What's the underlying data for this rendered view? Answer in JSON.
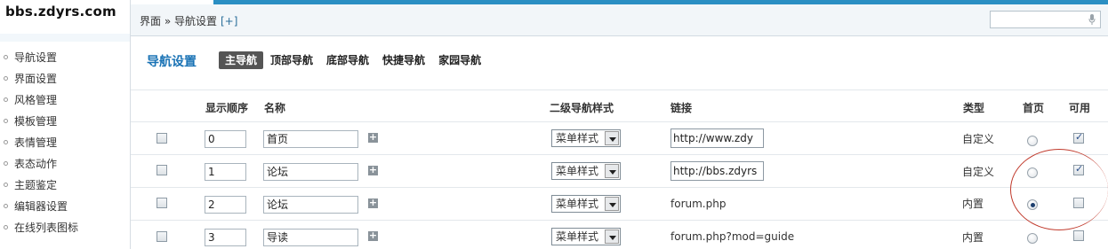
{
  "logo": {
    "text": "bbs.zdyrs.com"
  },
  "sidebar": {
    "items": [
      {
        "label": "导航设置"
      },
      {
        "label": "界面设置"
      },
      {
        "label": "风格管理"
      },
      {
        "label": "模板管理"
      },
      {
        "label": "表情管理"
      },
      {
        "label": "表态动作"
      },
      {
        "label": "主题鉴定"
      },
      {
        "label": "编辑器设置"
      },
      {
        "label": "在线列表图标"
      }
    ]
  },
  "topbar": {
    "breadcrumb": "界面 » 导航设置",
    "breadcrumb_add": "[+]",
    "search_placeholder": ""
  },
  "nav": {
    "title": "导航设置",
    "tabs": [
      {
        "label": "主导航",
        "active": true
      },
      {
        "label": "顶部导航",
        "active": false
      },
      {
        "label": "底部导航",
        "active": false
      },
      {
        "label": "快捷导航",
        "active": false
      },
      {
        "label": "家园导航",
        "active": false
      }
    ]
  },
  "table": {
    "headers": {
      "order": "显示顺序",
      "name": "名称",
      "subnav_style": "二级导航样式",
      "link": "链接",
      "type": "类型",
      "home": "首页",
      "available": "可用"
    },
    "rows": [
      {
        "selected": false,
        "order": "0",
        "name": "首页",
        "style": "菜单样式",
        "link": "http://www.zdy",
        "link_editable": true,
        "type": "自定义",
        "home": false,
        "available": true
      },
      {
        "selected": false,
        "order": "1",
        "name": "论坛",
        "style": "菜单样式",
        "link": "http://bbs.zdyrs",
        "link_editable": true,
        "type": "自定义",
        "home": false,
        "available": true
      },
      {
        "selected": false,
        "order": "2",
        "name": "论坛",
        "style": "菜单样式",
        "link": "forum.php",
        "link_editable": false,
        "type": "内置",
        "home": true,
        "available": false
      },
      {
        "selected": false,
        "order": "3",
        "name": "导读",
        "style": "菜单样式",
        "link": "forum.php?mod=guide",
        "link_editable": false,
        "type": "内置",
        "home": false,
        "available": false
      }
    ]
  },
  "colors": {
    "accent": "#2b8fc3",
    "title_blue": "#1a73b5",
    "highlight_ellipse": "#c0392b"
  }
}
